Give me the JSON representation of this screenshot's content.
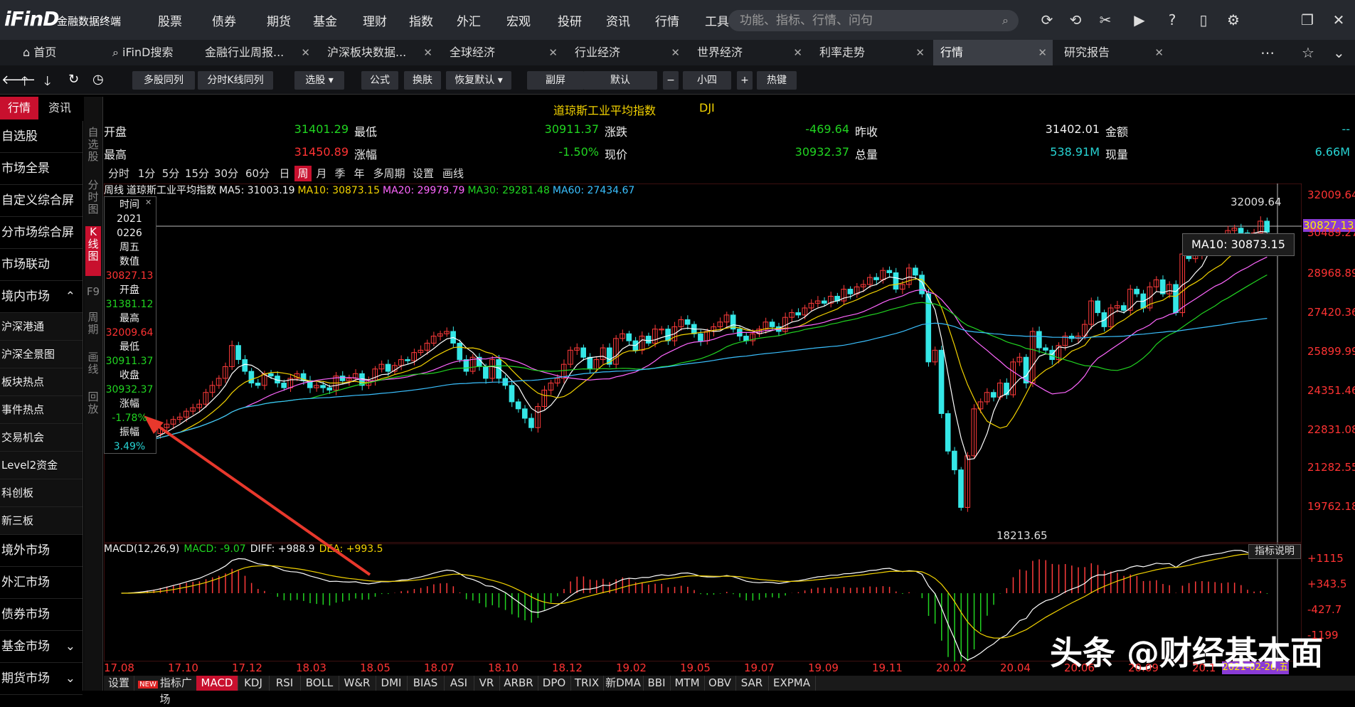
{
  "app": {
    "logo": "iFinD",
    "logo_sub": "金融数据终端"
  },
  "menu": [
    "股票",
    "债券",
    "期货",
    "基金",
    "理财",
    "指数",
    "外汇",
    "宏观",
    "投研",
    "资讯",
    "行情",
    "工具"
  ],
  "menu_dots": [
    true,
    true,
    false,
    true,
    true,
    false,
    false,
    true,
    true,
    false,
    false,
    false
  ],
  "search": {
    "placeholder": "功能、指标、行情、问句"
  },
  "top_icons": [
    "refresh-icon",
    "history-icon",
    "scissors-icon",
    "video-icon",
    "help-icon",
    "mobile-icon",
    "gear-icon",
    "restore-icon",
    "close-icon"
  ],
  "tabs": [
    {
      "label": "首页",
      "closable": false
    },
    {
      "label": "iFinD搜索",
      "closable": false
    },
    {
      "label": "金融行业周报...",
      "closable": true
    },
    {
      "label": "沪深板块数据...",
      "closable": true
    },
    {
      "label": "全球经济",
      "closable": true
    },
    {
      "label": "行业经济",
      "closable": true
    },
    {
      "label": "世界经济",
      "closable": true
    },
    {
      "label": "利率走势",
      "closable": true
    },
    {
      "label": "行情",
      "closable": true,
      "active": true
    },
    {
      "label": "研究报告",
      "closable": true
    }
  ],
  "toolbar": {
    "buttons": [
      "多股同列",
      "分时K线同列",
      "选股 ▾",
      "公式",
      "换肤",
      "恢复默认 ▾",
      "副屏",
      "默认",
      "−",
      "小四",
      "+",
      "热键"
    ]
  },
  "side_tabs": [
    "行情",
    "资讯"
  ],
  "nav": [
    {
      "label": "自选股",
      "small": false
    },
    {
      "label": "市场全景",
      "small": false
    },
    {
      "label": "自定义综合屏",
      "small": false
    },
    {
      "label": "分市场综合屏",
      "small": false
    },
    {
      "label": "市场联动",
      "small": false
    },
    {
      "label": "境内市场",
      "small": false,
      "chevron": "^"
    },
    {
      "label": "沪深港通",
      "small": true
    },
    {
      "label": "沪深全景图",
      "small": true
    },
    {
      "label": "板块热点",
      "small": true
    },
    {
      "label": "事件热点",
      "small": true
    },
    {
      "label": "交易机会",
      "small": true
    },
    {
      "label": "Level2资金",
      "small": true
    },
    {
      "label": "科创板",
      "small": true
    },
    {
      "label": "新三板",
      "small": true
    },
    {
      "label": "境外市场",
      "small": false
    },
    {
      "label": "外汇市场",
      "small": false
    },
    {
      "label": "债券市场",
      "small": false
    },
    {
      "label": "基金市场",
      "small": false,
      "chevron": "v"
    },
    {
      "label": "期货市场",
      "small": false,
      "chevron": "v"
    }
  ],
  "vertical_tabs": [
    "自选股",
    "分时图",
    "K线图",
    "F9",
    "周期",
    "画线",
    "回放"
  ],
  "quote": {
    "title": "道琼斯工业平均指数",
    "code": "DJI",
    "row1": [
      {
        "label": "开盘",
        "value": "31401.29",
        "color": "green"
      },
      {
        "label": "最低",
        "value": "30911.37",
        "color": "green"
      },
      {
        "label": "涨跌",
        "value": "-469.64",
        "color": "green"
      },
      {
        "label": "昨收",
        "value": "31402.01",
        "color": "white"
      },
      {
        "label": "金额",
        "value": "--",
        "color": "cyan"
      }
    ],
    "row2": [
      {
        "label": "最高",
        "value": "31450.89",
        "color": "red"
      },
      {
        "label": "涨幅",
        "value": "-1.50%",
        "color": "green"
      },
      {
        "label": "现价",
        "value": "30932.37",
        "color": "green"
      },
      {
        "label": "总量",
        "value": "538.91M",
        "color": "cyan"
      },
      {
        "label": "现量",
        "value": "6.66M",
        "color": "cyan"
      }
    ]
  },
  "periods": [
    "分时",
    "1分",
    "5分",
    "15分",
    "30分",
    "60分",
    "日",
    "周",
    "月",
    "季",
    "年",
    "多周期",
    "设置",
    "画线"
  ],
  "active_period": "周",
  "ma_line": {
    "prefix": "周线",
    "name": "道琼斯工业平均指数",
    "items": [
      {
        "text": "MA5: 31003.19",
        "color": "white"
      },
      {
        "text": "MA10: 30873.15",
        "color": "yellow"
      },
      {
        "text": "MA20: 29979.79",
        "color": "purple"
      },
      {
        "text": "MA30: 29281.48",
        "color": "green"
      },
      {
        "text": "MA60: 27434.67",
        "color": "blue"
      }
    ]
  },
  "info_box": [
    {
      "text": "时间",
      "color": "white"
    },
    {
      "text": "2021",
      "color": "white"
    },
    {
      "text": "0226",
      "color": "white"
    },
    {
      "text": "周五",
      "color": "white"
    },
    {
      "text": "数值",
      "color": "white"
    },
    {
      "text": "30827.13",
      "color": "red"
    },
    {
      "text": "开盘",
      "color": "white"
    },
    {
      "text": "31381.12",
      "color": "green"
    },
    {
      "text": "最高",
      "color": "white"
    },
    {
      "text": "32009.64",
      "color": "red"
    },
    {
      "text": "最低",
      "color": "white"
    },
    {
      "text": "30911.37",
      "color": "green"
    },
    {
      "text": "收盘",
      "color": "white"
    },
    {
      "text": "30932.37",
      "color": "green"
    },
    {
      "text": "涨幅",
      "color": "white"
    },
    {
      "text": "-1.78%",
      "color": "green"
    },
    {
      "text": "振幅",
      "color": "white"
    },
    {
      "text": "3.49%",
      "color": "cyan"
    }
  ],
  "tooltip": "MA10: 30873.15",
  "annotations": {
    "high": "32009.64",
    "low": "18213.65",
    "cursor_price": "30827.13",
    "cursor_date": "2021-02-26,五"
  },
  "macd": {
    "label": "MACD(12,26,9)",
    "items": [
      {
        "text": "MACD: -9.07",
        "color": "green"
      },
      {
        "text": "DIFF: +988.9",
        "color": "white"
      },
      {
        "text": "DEA: +993.5",
        "color": "yellow"
      }
    ],
    "explain": "指标说明"
  },
  "bottom_tabs": [
    "设置",
    "指标广场",
    "MACD",
    "KDJ",
    "RSI",
    "BOLL",
    "W&R",
    "DMI",
    "BIAS",
    "ASI",
    "VR",
    "ARBR",
    "DPO",
    "TRIX",
    "新DMA",
    "BBI",
    "MTM",
    "OBV",
    "SAR",
    "EXPMA"
  ],
  "bottom_new_badge": "NEW",
  "watermark": "头条 @财经基本面",
  "chart_data": {
    "type": "candlestick",
    "title": "道琼斯工业平均指数",
    "period": "周线",
    "y_ticks": [
      "32009.64",
      "30489.27",
      "28968.89",
      "27420.36",
      "25899.99",
      "24351.46",
      "22831.08",
      "21282.55",
      "19762.18"
    ],
    "macd_ticks": [
      "+1115",
      "+343.5",
      "-427.7",
      "-1199"
    ],
    "x_ticks": [
      "17.08",
      "17.10",
      "17.12",
      "18.03",
      "18.05",
      "18.07",
      "18.10",
      "18.12",
      "19.02",
      "19.05",
      "19.07",
      "19.09",
      "19.11",
      "20.02",
      "20.04",
      "20.06",
      "20.09",
      "20.1"
    ],
    "ylim": [
      18000,
      32700
    ],
    "closes": [
      21900,
      21950,
      22050,
      22150,
      22250,
      22350,
      22600,
      22750,
      22950,
      23050,
      23300,
      23450,
      23600,
      24100,
      24400,
      24700,
      25200,
      26100,
      25500,
      25000,
      24500,
      24400,
      24900,
      24800,
      24500,
      24300,
      24700,
      24900,
      24600,
      24300,
      24400,
      24300,
      24200,
      24800,
      24600,
      24700,
      24900,
      24400,
      24600,
      25100,
      25300,
      25000,
      25250,
      25500,
      25450,
      25800,
      25900,
      26200,
      26500,
      26600,
      26700,
      26200,
      25500,
      25000,
      25600,
      25200,
      24700,
      25500,
      24700,
      24400,
      23700,
      23400,
      23000,
      22600,
      23500,
      24200,
      24500,
      24700,
      25300,
      25900,
      26000,
      25600,
      25100,
      25500,
      26000,
      25300,
      26400,
      26600,
      26300,
      25900,
      26500,
      26200,
      26800,
      26800,
      26300,
      26900,
      27200,
      27000,
      26600,
      26300,
      26700,
      26900,
      27100,
      27400,
      26800,
      26500,
      26300,
      26600,
      26800,
      27100,
      26900,
      26700,
      27300,
      27500,
      27400,
      27700,
      27900,
      28000,
      27900,
      28200,
      28000,
      28500,
      28300,
      28600,
      28700,
      29000,
      28900,
      29300,
      29200,
      28500,
      28700,
      29400,
      29100,
      28300,
      25400,
      25900,
      23200,
      21600,
      20800,
      19200,
      21400,
      23400,
      23700,
      24100,
      23900,
      24500,
      24000,
      25400,
      25600,
      24500,
      26700,
      26000,
      25900,
      25500,
      26100,
      26500,
      26400,
      26500,
      27000,
      28000,
      27500,
      26900,
      27700,
      27800,
      27600,
      28500,
      28300,
      27700,
      28600,
      28900,
      28300,
      28700,
      27500,
      30000,
      29800,
      30000,
      30100,
      30200,
      30400,
      30500,
      31000,
      31100,
      30900,
      30500,
      30900,
      31400,
      30932
    ]
  }
}
